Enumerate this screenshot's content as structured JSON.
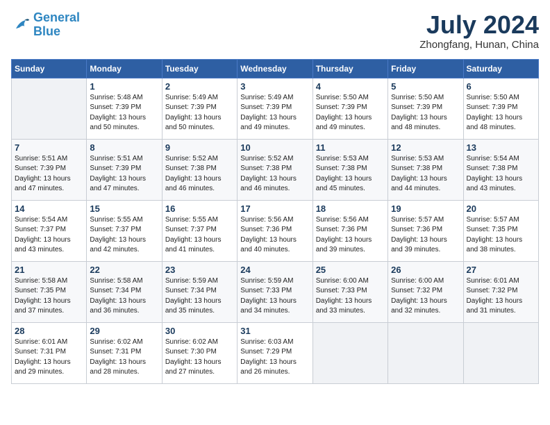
{
  "logo": {
    "line1": "General",
    "line2": "Blue"
  },
  "title": "July 2024",
  "location": "Zhongfang, Hunan, China",
  "headers": [
    "Sunday",
    "Monday",
    "Tuesday",
    "Wednesday",
    "Thursday",
    "Friday",
    "Saturday"
  ],
  "weeks": [
    [
      {
        "day": "",
        "sunrise": "",
        "sunset": "",
        "daylight": ""
      },
      {
        "day": "1",
        "sunrise": "Sunrise: 5:48 AM",
        "sunset": "Sunset: 7:39 PM",
        "daylight": "Daylight: 13 hours and 50 minutes."
      },
      {
        "day": "2",
        "sunrise": "Sunrise: 5:49 AM",
        "sunset": "Sunset: 7:39 PM",
        "daylight": "Daylight: 13 hours and 50 minutes."
      },
      {
        "day": "3",
        "sunrise": "Sunrise: 5:49 AM",
        "sunset": "Sunset: 7:39 PM",
        "daylight": "Daylight: 13 hours and 49 minutes."
      },
      {
        "day": "4",
        "sunrise": "Sunrise: 5:50 AM",
        "sunset": "Sunset: 7:39 PM",
        "daylight": "Daylight: 13 hours and 49 minutes."
      },
      {
        "day": "5",
        "sunrise": "Sunrise: 5:50 AM",
        "sunset": "Sunset: 7:39 PM",
        "daylight": "Daylight: 13 hours and 48 minutes."
      },
      {
        "day": "6",
        "sunrise": "Sunrise: 5:50 AM",
        "sunset": "Sunset: 7:39 PM",
        "daylight": "Daylight: 13 hours and 48 minutes."
      }
    ],
    [
      {
        "day": "7",
        "sunrise": "Sunrise: 5:51 AM",
        "sunset": "Sunset: 7:39 PM",
        "daylight": "Daylight: 13 hours and 47 minutes."
      },
      {
        "day": "8",
        "sunrise": "Sunrise: 5:51 AM",
        "sunset": "Sunset: 7:39 PM",
        "daylight": "Daylight: 13 hours and 47 minutes."
      },
      {
        "day": "9",
        "sunrise": "Sunrise: 5:52 AM",
        "sunset": "Sunset: 7:38 PM",
        "daylight": "Daylight: 13 hours and 46 minutes."
      },
      {
        "day": "10",
        "sunrise": "Sunrise: 5:52 AM",
        "sunset": "Sunset: 7:38 PM",
        "daylight": "Daylight: 13 hours and 46 minutes."
      },
      {
        "day": "11",
        "sunrise": "Sunrise: 5:53 AM",
        "sunset": "Sunset: 7:38 PM",
        "daylight": "Daylight: 13 hours and 45 minutes."
      },
      {
        "day": "12",
        "sunrise": "Sunrise: 5:53 AM",
        "sunset": "Sunset: 7:38 PM",
        "daylight": "Daylight: 13 hours and 44 minutes."
      },
      {
        "day": "13",
        "sunrise": "Sunrise: 5:54 AM",
        "sunset": "Sunset: 7:38 PM",
        "daylight": "Daylight: 13 hours and 43 minutes."
      }
    ],
    [
      {
        "day": "14",
        "sunrise": "Sunrise: 5:54 AM",
        "sunset": "Sunset: 7:37 PM",
        "daylight": "Daylight: 13 hours and 43 minutes."
      },
      {
        "day": "15",
        "sunrise": "Sunrise: 5:55 AM",
        "sunset": "Sunset: 7:37 PM",
        "daylight": "Daylight: 13 hours and 42 minutes."
      },
      {
        "day": "16",
        "sunrise": "Sunrise: 5:55 AM",
        "sunset": "Sunset: 7:37 PM",
        "daylight": "Daylight: 13 hours and 41 minutes."
      },
      {
        "day": "17",
        "sunrise": "Sunrise: 5:56 AM",
        "sunset": "Sunset: 7:36 PM",
        "daylight": "Daylight: 13 hours and 40 minutes."
      },
      {
        "day": "18",
        "sunrise": "Sunrise: 5:56 AM",
        "sunset": "Sunset: 7:36 PM",
        "daylight": "Daylight: 13 hours and 39 minutes."
      },
      {
        "day": "19",
        "sunrise": "Sunrise: 5:57 AM",
        "sunset": "Sunset: 7:36 PM",
        "daylight": "Daylight: 13 hours and 39 minutes."
      },
      {
        "day": "20",
        "sunrise": "Sunrise: 5:57 AM",
        "sunset": "Sunset: 7:35 PM",
        "daylight": "Daylight: 13 hours and 38 minutes."
      }
    ],
    [
      {
        "day": "21",
        "sunrise": "Sunrise: 5:58 AM",
        "sunset": "Sunset: 7:35 PM",
        "daylight": "Daylight: 13 hours and 37 minutes."
      },
      {
        "day": "22",
        "sunrise": "Sunrise: 5:58 AM",
        "sunset": "Sunset: 7:34 PM",
        "daylight": "Daylight: 13 hours and 36 minutes."
      },
      {
        "day": "23",
        "sunrise": "Sunrise: 5:59 AM",
        "sunset": "Sunset: 7:34 PM",
        "daylight": "Daylight: 13 hours and 35 minutes."
      },
      {
        "day": "24",
        "sunrise": "Sunrise: 5:59 AM",
        "sunset": "Sunset: 7:33 PM",
        "daylight": "Daylight: 13 hours and 34 minutes."
      },
      {
        "day": "25",
        "sunrise": "Sunrise: 6:00 AM",
        "sunset": "Sunset: 7:33 PM",
        "daylight": "Daylight: 13 hours and 33 minutes."
      },
      {
        "day": "26",
        "sunrise": "Sunrise: 6:00 AM",
        "sunset": "Sunset: 7:32 PM",
        "daylight": "Daylight: 13 hours and 32 minutes."
      },
      {
        "day": "27",
        "sunrise": "Sunrise: 6:01 AM",
        "sunset": "Sunset: 7:32 PM",
        "daylight": "Daylight: 13 hours and 31 minutes."
      }
    ],
    [
      {
        "day": "28",
        "sunrise": "Sunrise: 6:01 AM",
        "sunset": "Sunset: 7:31 PM",
        "daylight": "Daylight: 13 hours and 29 minutes."
      },
      {
        "day": "29",
        "sunrise": "Sunrise: 6:02 AM",
        "sunset": "Sunset: 7:31 PM",
        "daylight": "Daylight: 13 hours and 28 minutes."
      },
      {
        "day": "30",
        "sunrise": "Sunrise: 6:02 AM",
        "sunset": "Sunset: 7:30 PM",
        "daylight": "Daylight: 13 hours and 27 minutes."
      },
      {
        "day": "31",
        "sunrise": "Sunrise: 6:03 AM",
        "sunset": "Sunset: 7:29 PM",
        "daylight": "Daylight: 13 hours and 26 minutes."
      },
      {
        "day": "",
        "sunrise": "",
        "sunset": "",
        "daylight": ""
      },
      {
        "day": "",
        "sunrise": "",
        "sunset": "",
        "daylight": ""
      },
      {
        "day": "",
        "sunrise": "",
        "sunset": "",
        "daylight": ""
      }
    ]
  ]
}
